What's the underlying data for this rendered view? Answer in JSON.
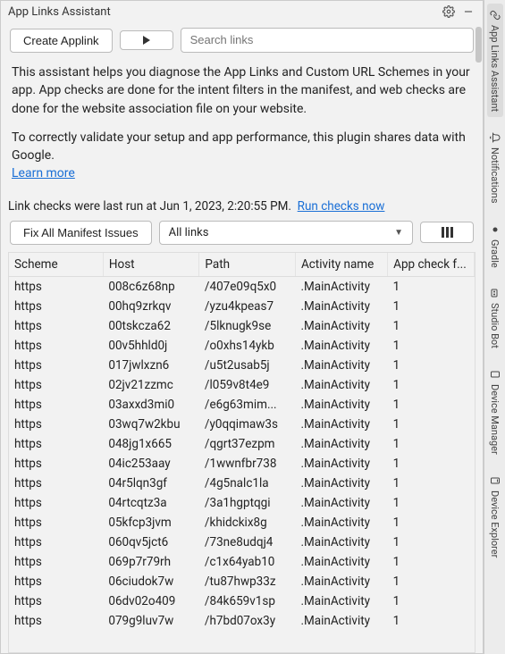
{
  "titlebar": {
    "title": "App Links Assistant"
  },
  "toolbar": {
    "create_label": "Create Applink",
    "search_placeholder": "Search links"
  },
  "description": {
    "p1": "This assistant helps you diagnose the App Links and Custom URL Schemes in your app. App checks are done for the intent filters in the manifest, and web checks are done for the website association file on your website.",
    "p2": "To correctly validate your setup and app performance, this plugin shares data with Google.",
    "learn_more": "Learn more"
  },
  "status": {
    "prefix": "Link checks were last run at ",
    "timestamp": "Jun 1, 2023, 2:20:55 PM.",
    "run_now": "Run checks now"
  },
  "filters": {
    "fix_label": "Fix All Manifest Issues",
    "select_value": "All links"
  },
  "table": {
    "headers": {
      "scheme": "Scheme",
      "host": "Host",
      "path": "Path",
      "activity": "Activity name",
      "check": "App check f..."
    },
    "rows": [
      {
        "scheme": "https",
        "host": "008c6z68np",
        "path": "/407e09q5x0",
        "activity": ".MainActivity",
        "check": "1"
      },
      {
        "scheme": "https",
        "host": "00hq9zrkqv",
        "path": "/yzu4kpeas7",
        "activity": ".MainActivity",
        "check": "1"
      },
      {
        "scheme": "https",
        "host": "00tskcza62",
        "path": "/5lknugk9se",
        "activity": ".MainActivity",
        "check": "1"
      },
      {
        "scheme": "https",
        "host": "00v5hhld0j",
        "path": "/o0xhs14ykb",
        "activity": ".MainActivity",
        "check": "1"
      },
      {
        "scheme": "https",
        "host": "017jwlxzn6",
        "path": "/u5t2usab5j",
        "activity": ".MainActivity",
        "check": "1"
      },
      {
        "scheme": "https",
        "host": "02jv21zzmc",
        "path": "/l059v8t4e9",
        "activity": ".MainActivity",
        "check": "1"
      },
      {
        "scheme": "https",
        "host": "03axxd3mi0",
        "path": "/e6g63mim...",
        "activity": ".MainActivity",
        "check": "1"
      },
      {
        "scheme": "https",
        "host": "03wq7w2kbu",
        "path": "/y0qqimaw3s",
        "activity": ".MainActivity",
        "check": "1"
      },
      {
        "scheme": "https",
        "host": "048jg1x665",
        "path": "/qgrt37ezpm",
        "activity": ".MainActivity",
        "check": "1"
      },
      {
        "scheme": "https",
        "host": "04ic253aay",
        "path": "/1wwnfbr738",
        "activity": ".MainActivity",
        "check": "1"
      },
      {
        "scheme": "https",
        "host": "04r5lqn3gf",
        "path": "/4g5nalc1la",
        "activity": ".MainActivity",
        "check": "1"
      },
      {
        "scheme": "https",
        "host": "04rtcqtz3a",
        "path": "/3a1hgptqgi",
        "activity": ".MainActivity",
        "check": "1"
      },
      {
        "scheme": "https",
        "host": "05kfcp3jvm",
        "path": "/khidckix8g",
        "activity": ".MainActivity",
        "check": "1"
      },
      {
        "scheme": "https",
        "host": "060qv5jct6",
        "path": "/73ne8udqj4",
        "activity": ".MainActivity",
        "check": "1"
      },
      {
        "scheme": "https",
        "host": "069p7r79rh",
        "path": "/c1x64yab10",
        "activity": ".MainActivity",
        "check": "1"
      },
      {
        "scheme": "https",
        "host": "06ciudok7w",
        "path": "/tu87hwp33z",
        "activity": ".MainActivity",
        "check": "1"
      },
      {
        "scheme": "https",
        "host": "06dv02o409",
        "path": "/84k659v1sp",
        "activity": ".MainActivity",
        "check": "1"
      },
      {
        "scheme": "https",
        "host": "079g9luv7w",
        "path": "/h7bd07ox3y",
        "activity": ".MainActivity",
        "check": "1"
      }
    ]
  },
  "rail": {
    "items": [
      {
        "label": "App Links Assistant",
        "icon": "link"
      },
      {
        "label": "Notifications",
        "icon": "bell"
      },
      {
        "label": "Gradle",
        "icon": "elephant"
      },
      {
        "label": "Studio Bot",
        "icon": "bot"
      },
      {
        "label": "Device Manager",
        "icon": "devices"
      },
      {
        "label": "Device Explorer",
        "icon": "folder"
      }
    ]
  }
}
